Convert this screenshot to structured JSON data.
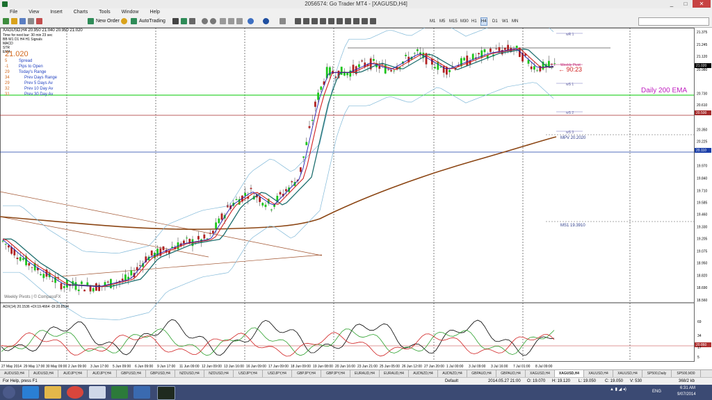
{
  "window": {
    "title": "2056574: Go Trader MT4 - [XAGUSD,H4]",
    "min": "_",
    "max": "□",
    "close": "✕"
  },
  "menu": [
    "File",
    "View",
    "Insert",
    "Charts",
    "Tools",
    "Window",
    "Help"
  ],
  "toolbar": {
    "new_order": "New Order",
    "autotrading": "AutoTrading",
    "timeframes": [
      "M1",
      "M5",
      "M15",
      "M30",
      "H1",
      "H4",
      "D1",
      "W1",
      "MN"
    ],
    "active_tf": "H4"
  },
  "chart": {
    "ohlc": "XAGUSD,H4  20.950 21.040 20.950 21.020",
    "info_lines": [
      "Time for next bar: 30 min 23 sec",
      "BB  W1  D1  H4  H1  Signals",
      "MACD",
      "STR",
      "EMA"
    ],
    "big_price": "21.020",
    "table": [
      {
        "n": "5",
        "label": "Spread"
      },
      {
        "n": "-1",
        "label": "Pips to Open"
      },
      {
        "n": "29",
        "label": "Today's Range"
      },
      {
        "n": "34",
        "label": "Prev Days Range"
      },
      {
        "n": "29",
        "label": "Prev 5 Days Av"
      },
      {
        "n": "32",
        "label": "Prev 10 Day Av"
      },
      {
        "n": "31",
        "label": "Prev 30 Day Av"
      }
    ],
    "watermark": "Weekly Pivots | © CompassFX",
    "labels": {
      "wr1": "wR 1",
      "ws1": "wS 1",
      "ws2": "wS 2",
      "ws3": "wS 3",
      "weekly_pivot": "Weekly Pivot",
      "countdown": "← 90:23",
      "daily200": "Daily 200 EMA",
      "mpv": "MPV  20.2020",
      "ms1": "MS1  19.3910"
    },
    "price_axis": [
      "21.375",
      "21.245",
      "21.120",
      "20.980",
      "20.730",
      "20.610",
      "20.350",
      "20.225",
      "19.970",
      "19.840",
      "19.710",
      "19.585",
      "19.460",
      "19.330",
      "19.205",
      "19.075",
      "18.950",
      "18.820",
      "18.690",
      "18.560"
    ],
    "price_tags": [
      {
        "text": "21.020",
        "color": "#000000"
      },
      {
        "text": "20.500",
        "color": "#a52a2a"
      },
      {
        "text": "20.110",
        "color": "#1a3ea8"
      },
      {
        "text": "20.860",
        "color": "#b03030"
      }
    ],
    "adx_label": "ADX(14) 20.1536 +DI:19.4664 -DI:20.8534",
    "adx_axis": [
      "69",
      "34",
      "17",
      "5"
    ],
    "time_axis": [
      "27 May 2014",
      "29 May 17:00",
      "30 May 09:00",
      "2 Jun 09:00",
      "3 Jun 17:00",
      "5 Jun 09:00",
      "6 Jun 09:00",
      "9 Jun 17:00",
      "11 Jun 09:00",
      "12 Jun 09:00",
      "13 Jun 16:00",
      "16 Jun 09:00",
      "17 Jun 09:00",
      "18 Jun 09:00",
      "19 Jun 08:00",
      "20 Jun 16:00",
      "23 Jun 21:00",
      "25 Jun 05:00",
      "26 Jun 12:00",
      "27 Jun 20:00",
      "1 Jul 00:00",
      "3 Jul 09:00",
      "3 Jul 16:00",
      "7 Jul 01:00",
      "8 Jul 09:00"
    ]
  },
  "tabs": [
    "AUDUSD,H4",
    "AUDUSD,H4",
    "AUDJPY,H4",
    "AUDJPY,H4",
    "GBPUSD,H4",
    "GBPUSD,H4",
    "NZDUSD,H4",
    "NZDUSD,H4",
    "USDJPY,H4",
    "USDJPY,H4",
    "GBPJPY,H4",
    "GBPJPY,H4",
    "EURAUD,H4",
    "EURAUD,H4",
    "AUDNZD,H4",
    "AUDNZD,H4",
    "GBPAUD,H4",
    "GBPAUD,H4",
    "XAGUSD,H4",
    "XAGUSD,H4",
    "XAUUSD,H4",
    "XAUUSD,H4",
    "SP500,Daily",
    "SP500,M30"
  ],
  "active_tab_index": 19,
  "status": {
    "help": "For Help, press F1",
    "profile": "Default",
    "time": "2014.05.27 21:00",
    "o": "O: 19.070",
    "h": "H: 19.120",
    "l": "L: 19.050",
    "c": "C: 19.050",
    "v": "V: 530",
    "kb": "368/2 kb"
  },
  "taskbar": {
    "lang": "ENG",
    "clock": "6:31 AM",
    "date": "9/07/2014"
  }
}
